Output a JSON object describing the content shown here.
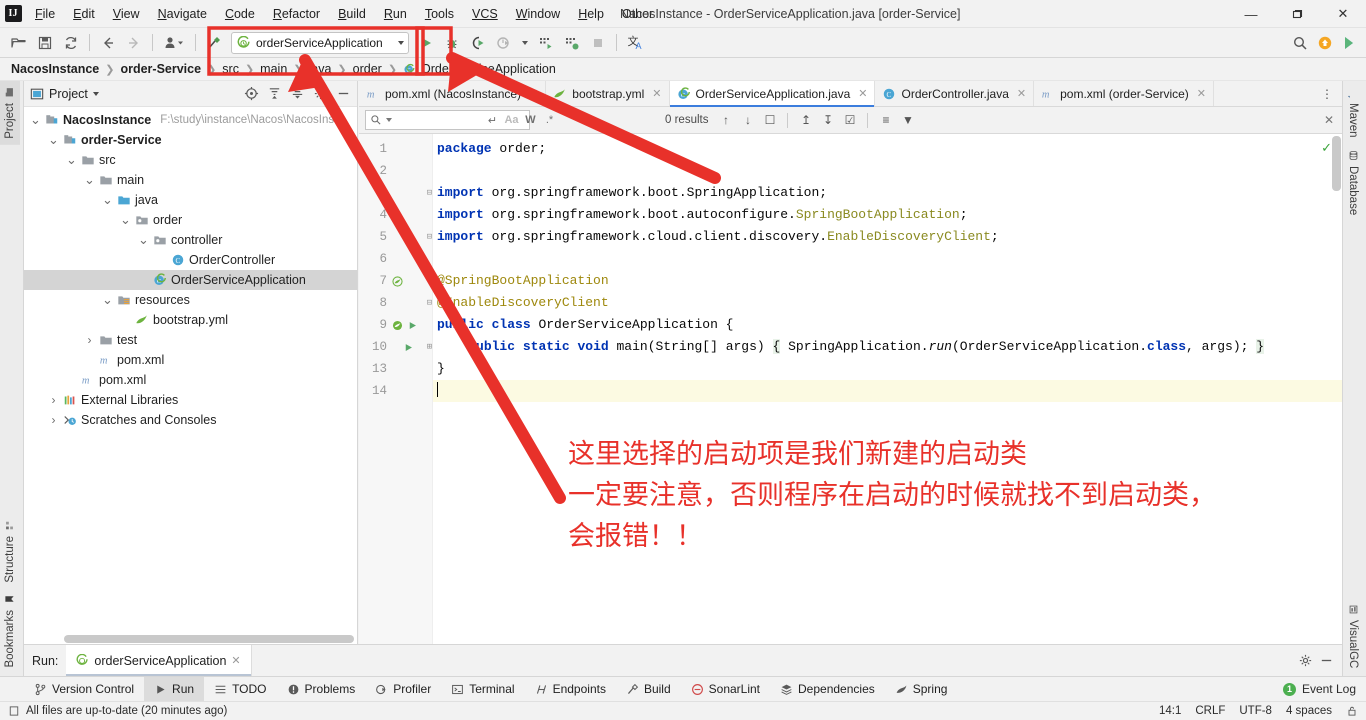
{
  "window": {
    "title": "NacosInstance - OrderServiceApplication.java [order-Service]",
    "minimize": "—",
    "maximize": "❐",
    "close": "✕",
    "logo": "IJ"
  },
  "menubar": [
    {
      "label": "File"
    },
    {
      "label": "Edit"
    },
    {
      "label": "View"
    },
    {
      "label": "Navigate"
    },
    {
      "label": "Code"
    },
    {
      "label": "Refactor"
    },
    {
      "label": "Build"
    },
    {
      "label": "Run"
    },
    {
      "label": "Tools"
    },
    {
      "label": "VCS"
    },
    {
      "label": "Window"
    },
    {
      "label": "Help"
    },
    {
      "label": "Other"
    }
  ],
  "toolbar": {
    "run_config_name": "orderServiceApplication",
    "icons": [
      "open-folder-icon",
      "save-icon",
      "sync-icon",
      "back-arrow-icon",
      "forward-arrow-icon",
      "user-dropdown-icon",
      "hammer-icon"
    ],
    "run_icons": [
      "run-icon",
      "debug-icon",
      "run-with-coverage-icon",
      "profile-icon",
      "profile-dropdown-icon",
      "build-icon",
      "build-run-icon",
      "stop-icon",
      "translate-icon"
    ],
    "right_icons": [
      "search-icon",
      "update-icon",
      "ide-feature-icon"
    ]
  },
  "breadcrumb": [
    {
      "label": "NacosInstance",
      "bold": true
    },
    {
      "label": "order-Service",
      "bold": true
    },
    {
      "label": "src",
      "bold": false
    },
    {
      "label": "main",
      "bold": false
    },
    {
      "label": "java",
      "bold": false
    },
    {
      "label": "order",
      "bold": false
    },
    {
      "label": "OrderServiceApplication",
      "bold": false
    }
  ],
  "left_rail": {
    "top": [
      {
        "label": "Project",
        "icon": "project-icon",
        "active": true
      }
    ],
    "bottom": [
      {
        "label": "Structure",
        "icon": "structure-icon"
      },
      {
        "label": "Bookmarks",
        "icon": "bookmark-icon"
      }
    ]
  },
  "right_rail": [
    {
      "label": "Maven",
      "icon": "maven-icon"
    },
    {
      "label": "Database",
      "icon": "database-icon"
    },
    {
      "label": "VisualGC",
      "icon": "visualgc-icon"
    }
  ],
  "project_panel": {
    "title": "Project",
    "header_icons": [
      "target-icon",
      "expand-all-icon",
      "collapse-all-icon",
      "settings-icon",
      "hide-icon"
    ],
    "tree": [
      {
        "depth": 0,
        "label": "NacosInstance",
        "bold": true,
        "arrow": "down",
        "icon": "module-icon",
        "path": "F:\\study\\instance\\Nacos\\NacosIns",
        "selected": false
      },
      {
        "depth": 1,
        "label": "order-Service",
        "bold": true,
        "arrow": "down",
        "icon": "module-icon",
        "path": "",
        "selected": false
      },
      {
        "depth": 2,
        "label": "src",
        "bold": false,
        "arrow": "down",
        "icon": "folder-icon",
        "path": "",
        "selected": false
      },
      {
        "depth": 3,
        "label": "main",
        "bold": false,
        "arrow": "down",
        "icon": "folder-icon",
        "path": "",
        "selected": false
      },
      {
        "depth": 4,
        "label": "java",
        "bold": false,
        "arrow": "down",
        "icon": "source-folder-icon",
        "path": "",
        "selected": false
      },
      {
        "depth": 5,
        "label": "order",
        "bold": false,
        "arrow": "down",
        "icon": "package-icon",
        "path": "",
        "selected": false
      },
      {
        "depth": 6,
        "label": "controller",
        "bold": false,
        "arrow": "down",
        "icon": "package-icon",
        "path": "",
        "selected": false
      },
      {
        "depth": 7,
        "label": "OrderController",
        "bold": false,
        "arrow": "none",
        "icon": "java-class-icon",
        "path": "",
        "selected": false
      },
      {
        "depth": 6,
        "label": "OrderServiceApplication",
        "bold": false,
        "arrow": "none",
        "icon": "spring-class-icon",
        "path": "",
        "selected": true
      },
      {
        "depth": 4,
        "label": "resources",
        "bold": false,
        "arrow": "down",
        "icon": "resource-folder-icon",
        "path": "",
        "selected": false
      },
      {
        "depth": 5,
        "label": "bootstrap.yml",
        "bold": false,
        "arrow": "none",
        "icon": "spring-yml-icon",
        "path": "",
        "selected": false
      },
      {
        "depth": 3,
        "label": "test",
        "bold": false,
        "arrow": "right",
        "icon": "folder-icon",
        "path": "",
        "selected": false
      },
      {
        "depth": 3,
        "label": "pom.xml",
        "bold": false,
        "arrow": "none",
        "icon": "maven-file-icon",
        "path": "",
        "selected": false
      },
      {
        "depth": 2,
        "label": "pom.xml",
        "bold": false,
        "arrow": "none",
        "icon": "maven-file-icon",
        "path": "",
        "selected": false
      },
      {
        "depth": 1,
        "label": "External Libraries",
        "bold": false,
        "arrow": "right",
        "icon": "libraries-icon",
        "path": "",
        "selected": false
      },
      {
        "depth": 1,
        "label": "Scratches and Consoles",
        "bold": false,
        "arrow": "right",
        "icon": "scratches-icon",
        "path": "",
        "selected": false
      }
    ]
  },
  "editor": {
    "tabs": [
      {
        "label": "pom.xml (NacosInstance)",
        "icon": "maven-file-icon",
        "active": false
      },
      {
        "label": "bootstrap.yml",
        "icon": "spring-yml-icon",
        "active": false
      },
      {
        "label": "OrderServiceApplication.java",
        "icon": "spring-class-icon",
        "active": true
      },
      {
        "label": "OrderController.java",
        "icon": "java-class-icon",
        "active": false
      },
      {
        "label": "pom.xml (order-Service)",
        "icon": "maven-file-icon",
        "active": false
      }
    ],
    "tab_overflow": "⋮",
    "find": {
      "placeholder": "",
      "value": "",
      "results": "0 results",
      "icons": [
        "regex-history-icon",
        "match-case-icon",
        "words-icon",
        "regex-icon"
      ],
      "nav_icons": [
        "find-previous-icon",
        "find-next-icon",
        "select-all-icon",
        "add-selection-icon",
        "remove-selection-icon",
        "select-occurrences-icon",
        "filter-list-icon",
        "filter-icon"
      ],
      "close": "✕"
    },
    "line_numbers": [
      "1",
      "2",
      "3",
      "4",
      "5",
      "6",
      "7",
      "8",
      "9",
      "10",
      "13",
      "14"
    ],
    "lines": [
      {
        "num": "1",
        "html_tokens": [
          {
            "t": "package",
            "c": "kw"
          },
          {
            "t": " order;",
            "c": "plain"
          }
        ],
        "gutter_icon": "",
        "fold": "",
        "highlight": false
      },
      {
        "num": "2",
        "html_tokens": [],
        "gutter_icon": "",
        "fold": "",
        "highlight": false
      },
      {
        "num": "3",
        "html_tokens": [
          {
            "t": "import",
            "c": "kw"
          },
          {
            "t": " org.springframework.boot.SpringApplication;",
            "c": "plain"
          }
        ],
        "gutter_icon": "",
        "fold": "minus",
        "highlight": false
      },
      {
        "num": "4",
        "html_tokens": [
          {
            "t": "import",
            "c": "kw"
          },
          {
            "t": " org.springframework.boot.autoconfigure.",
            "c": "plain"
          },
          {
            "t": "SpringBootApplication",
            "c": "cls"
          },
          {
            "t": ";",
            "c": "plain"
          }
        ],
        "gutter_icon": "",
        "fold": "",
        "highlight": false
      },
      {
        "num": "5",
        "html_tokens": [
          {
            "t": "import",
            "c": "kw"
          },
          {
            "t": " org.springframework.cloud.client.discovery.",
            "c": "plain"
          },
          {
            "t": "EnableDiscoveryClient",
            "c": "cls"
          },
          {
            "t": ";",
            "c": "plain"
          }
        ],
        "gutter_icon": "",
        "fold": "minus",
        "highlight": false
      },
      {
        "num": "6",
        "html_tokens": [],
        "gutter_icon": "",
        "fold": "",
        "highlight": false
      },
      {
        "num": "7",
        "html_tokens": [
          {
            "t": "@SpringBootApplication",
            "c": "ann"
          }
        ],
        "gutter_icon": "spring-bean-icon",
        "fold": "",
        "highlight": false
      },
      {
        "num": "8",
        "html_tokens": [
          {
            "t": "@EnableDiscoveryClient",
            "c": "ann"
          }
        ],
        "gutter_icon": "",
        "fold": "minus",
        "highlight": false
      },
      {
        "num": "9",
        "html_tokens": [
          {
            "t": "public",
            "c": "kw"
          },
          {
            "t": " ",
            "c": "plain"
          },
          {
            "t": "class",
            "c": "kw"
          },
          {
            "t": " OrderServiceApplication {",
            "c": "plain"
          }
        ],
        "gutter_icon": "spring-run-icon",
        "fold": "",
        "highlight": false
      },
      {
        "num": "10",
        "html_tokens": [
          {
            "t": "    ",
            "c": "plain"
          },
          {
            "t": "public",
            "c": "kw"
          },
          {
            "t": " ",
            "c": "plain"
          },
          {
            "t": "static",
            "c": "kw"
          },
          {
            "t": " ",
            "c": "plain"
          },
          {
            "t": "void",
            "c": "kw"
          },
          {
            "t": " main(String[] args) ",
            "c": "plain"
          },
          {
            "t": "{",
            "c": "brace"
          },
          {
            "t": " SpringApplication.",
            "c": "plain"
          },
          {
            "t": "run",
            "c": "ital"
          },
          {
            "t": "(OrderServiceApplication.",
            "c": "plain"
          },
          {
            "t": "class",
            "c": "kw"
          },
          {
            "t": ", args); ",
            "c": "plain"
          },
          {
            "t": "}",
            "c": "brace"
          }
        ],
        "gutter_icon": "run-method-icon",
        "fold": "plus",
        "highlight": false
      },
      {
        "num": "13",
        "html_tokens": [
          {
            "t": "}",
            "c": "plain"
          }
        ],
        "gutter_icon": "",
        "fold": "",
        "highlight": false
      },
      {
        "num": "14",
        "html_tokens": [],
        "gutter_icon": "",
        "fold": "",
        "highlight": true,
        "caret": true
      }
    ],
    "inspection_status": "✓"
  },
  "annotation": {
    "text": "这里选择的启动项是我们新建的启动类\n一定要注意，否则程序在启动的时候就找不到启动类，\n会报错！！",
    "color": "#e8312a"
  },
  "run_panel": {
    "label": "Run:",
    "tab_label": "orderServiceApplication",
    "tab_icon": "spring-class-icon",
    "close": "✕",
    "right_icons": [
      "settings-gear-icon",
      "minimize-icon"
    ]
  },
  "bottom_tools": [
    {
      "label": "Version Control",
      "icon": "branch-icon",
      "active": false
    },
    {
      "label": "Run",
      "icon": "run-icon",
      "active": true
    },
    {
      "label": "TODO",
      "icon": "todo-icon",
      "active": false
    },
    {
      "label": "Problems",
      "icon": "problems-icon",
      "active": false
    },
    {
      "label": "Profiler",
      "icon": "profiler-icon",
      "active": false
    },
    {
      "label": "Terminal",
      "icon": "terminal-icon",
      "active": false
    },
    {
      "label": "Endpoints",
      "icon": "endpoints-icon",
      "active": false
    },
    {
      "label": "Build",
      "icon": "build-hammer-icon",
      "active": false
    },
    {
      "label": "SonarLint",
      "icon": "sonarlint-icon",
      "active": false
    },
    {
      "label": "Dependencies",
      "icon": "dependencies-icon",
      "active": false
    },
    {
      "label": "Spring",
      "icon": "spring-leaf-icon",
      "active": false
    }
  ],
  "event_log": {
    "label": "Event Log",
    "count": "1"
  },
  "statusbar": {
    "message": "All files are up-to-date (20 minutes ago)",
    "message_icon": "file-sync-icon",
    "caret_position": "14:1",
    "line_separator": "CRLF",
    "encoding": "UTF-8",
    "indent": "4 spaces",
    "lock_icon": "lock-icon"
  }
}
